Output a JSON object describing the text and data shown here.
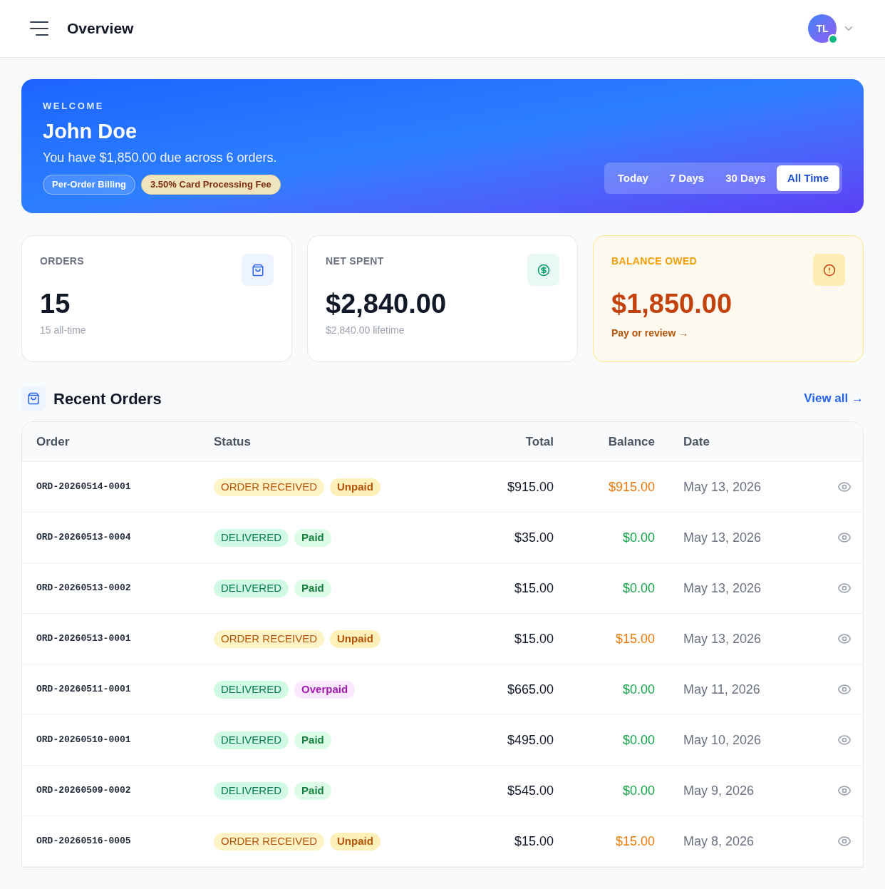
{
  "header": {
    "title": "Overview",
    "avatar": "TL",
    "online": true
  },
  "hero": {
    "eyebrow": "WELCOME",
    "name": "John Doe",
    "message": "You have $1,850.00 due across 6 orders.",
    "badges": [
      {
        "label": "Per-Order Billing",
        "kind": "outline"
      },
      {
        "label": "3.50% Card Processing Fee",
        "kind": "fee"
      }
    ],
    "ranges": [
      {
        "label": "Today",
        "selected": false
      },
      {
        "label": "7 Days",
        "selected": false
      },
      {
        "label": "30 Days",
        "selected": false
      },
      {
        "label": "All Time",
        "selected": true
      }
    ]
  },
  "stats": [
    {
      "kind": "orders",
      "label": "ORDERS",
      "value": "15",
      "note": "15 all-time"
    },
    {
      "kind": "spent",
      "label": "NET SPENT",
      "value": "$2,840.00",
      "note": "$2,840.00 lifetime"
    },
    {
      "kind": "balance",
      "label": "BALANCE OWED",
      "value": "$1,850.00",
      "link": "Pay or review →"
    }
  ],
  "recent_orders": {
    "title": "Recent Orders",
    "view_all": "View all →",
    "columns": [
      "Order",
      "Status",
      "Total",
      "Balance",
      "Date"
    ],
    "rows": [
      {
        "order": "ORD-20260514-0001",
        "status": {
          "label": "ORDER RECEIVED",
          "kind": "received"
        },
        "payment": {
          "label": "Unpaid",
          "kind": "unpaid"
        },
        "total": "$915.00",
        "balance": "$915.00",
        "due": true,
        "date": "May 13, 2026"
      },
      {
        "order": "ORD-20260513-0004",
        "status": {
          "label": "DELIVERED",
          "kind": "delivered"
        },
        "payment": {
          "label": "Paid",
          "kind": "paid"
        },
        "total": "$35.00",
        "balance": "$0.00",
        "due": false,
        "date": "May 13, 2026"
      },
      {
        "order": "ORD-20260513-0002",
        "status": {
          "label": "DELIVERED",
          "kind": "delivered"
        },
        "payment": {
          "label": "Paid",
          "kind": "paid"
        },
        "total": "$15.00",
        "balance": "$0.00",
        "due": false,
        "date": "May 13, 2026"
      },
      {
        "order": "ORD-20260513-0001",
        "status": {
          "label": "ORDER RECEIVED",
          "kind": "received"
        },
        "payment": {
          "label": "Unpaid",
          "kind": "unpaid"
        },
        "total": "$15.00",
        "balance": "$15.00",
        "due": true,
        "date": "May 13, 2026"
      },
      {
        "order": "ORD-20260511-0001",
        "status": {
          "label": "DELIVERED",
          "kind": "delivered"
        },
        "payment": {
          "label": "Overpaid",
          "kind": "overpaid"
        },
        "total": "$665.00",
        "balance": "$0.00",
        "due": false,
        "date": "May 11, 2026"
      },
      {
        "order": "ORD-20260510-0001",
        "status": {
          "label": "DELIVERED",
          "kind": "delivered"
        },
        "payment": {
          "label": "Paid",
          "kind": "paid"
        },
        "total": "$495.00",
        "balance": "$0.00",
        "due": false,
        "date": "May 10, 2026"
      },
      {
        "order": "ORD-20260509-0002",
        "status": {
          "label": "DELIVERED",
          "kind": "delivered"
        },
        "payment": {
          "label": "Paid",
          "kind": "paid"
        },
        "total": "$545.00",
        "balance": "$0.00",
        "due": false,
        "date": "May 9, 2026"
      },
      {
        "order": "ORD-20260516-0005",
        "status": {
          "label": "ORDER RECEIVED",
          "kind": "received"
        },
        "payment": {
          "label": "Unpaid",
          "kind": "unpaid"
        },
        "total": "$15.00",
        "balance": "$15.00",
        "due": true,
        "date": "May 8, 2026"
      }
    ]
  }
}
